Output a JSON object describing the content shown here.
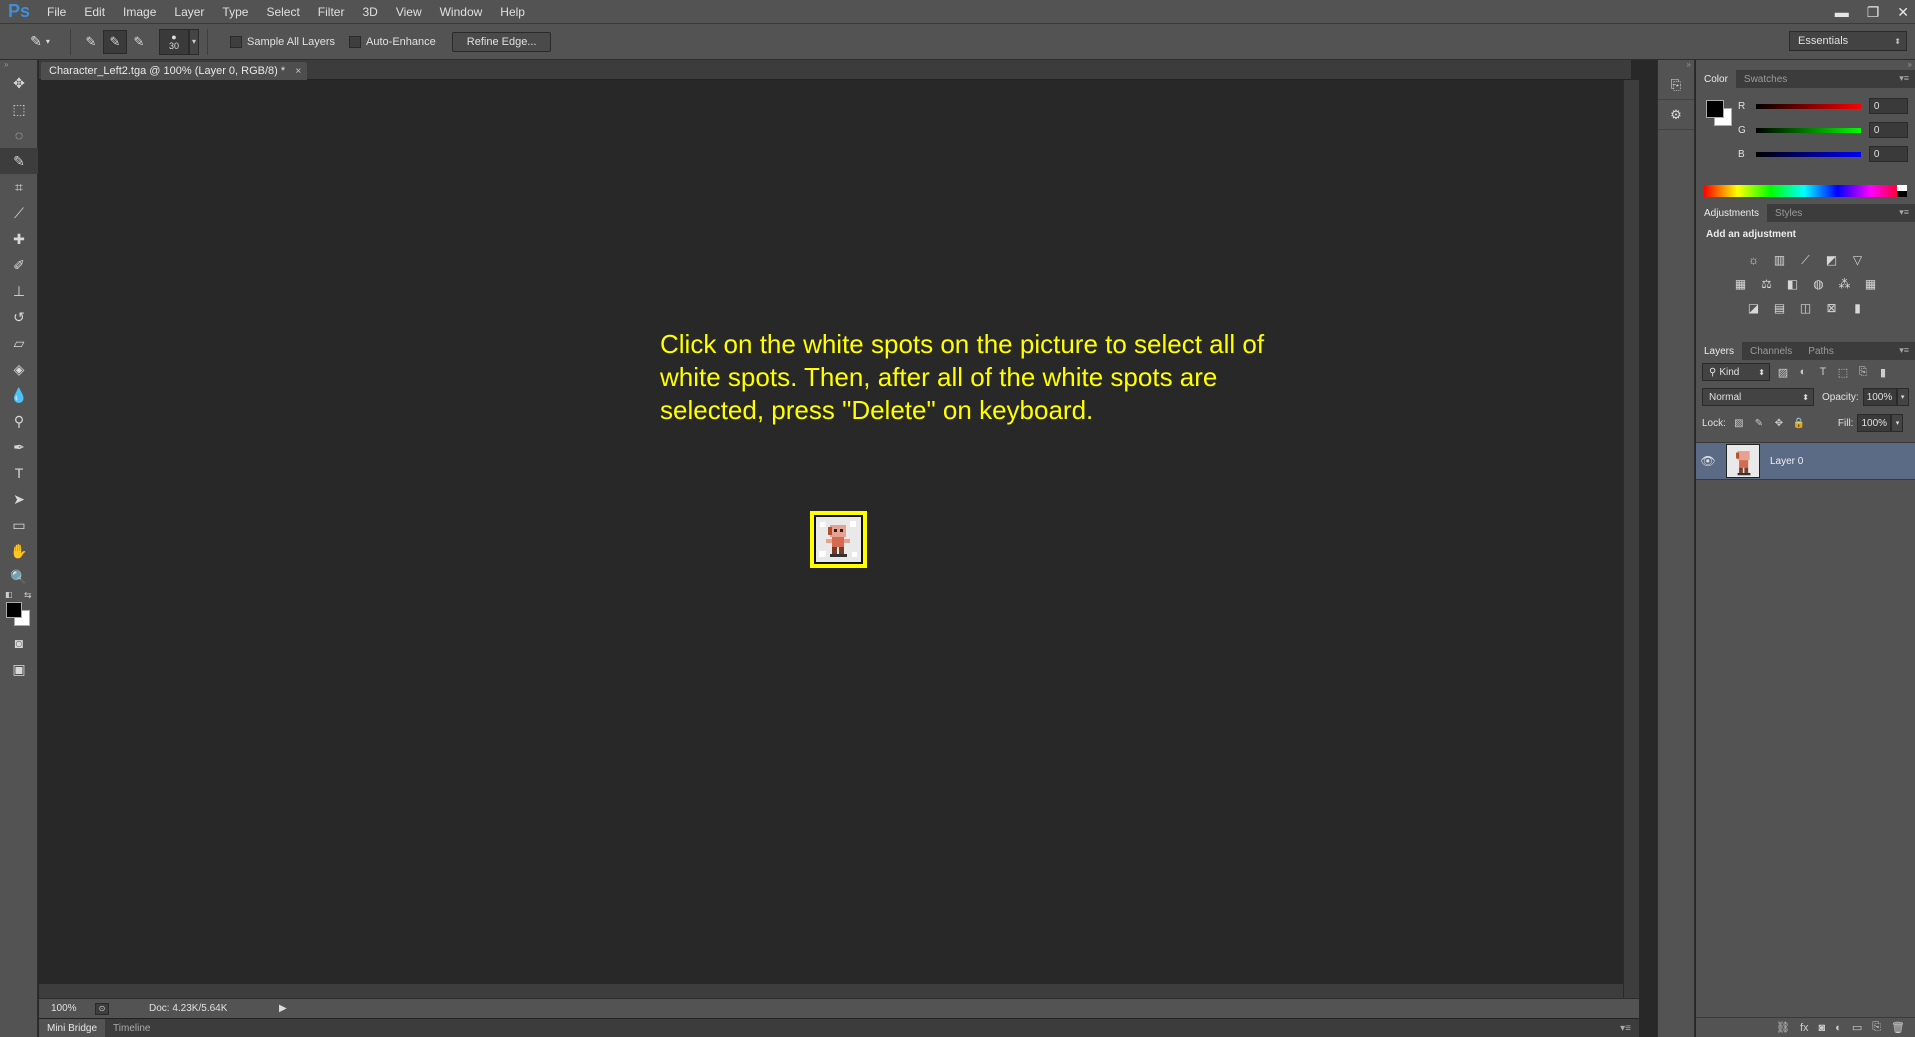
{
  "app": {
    "logo": "Ps"
  },
  "menu": [
    "File",
    "Edit",
    "Image",
    "Layer",
    "Type",
    "Select",
    "Filter",
    "3D",
    "View",
    "Window",
    "Help"
  ],
  "window_controls": {
    "minimize": "▬",
    "restore": "❐",
    "close": "✕"
  },
  "options": {
    "brush_size": "30",
    "sample_all_layers": "Sample All Layers",
    "auto_enhance": "Auto-Enhance",
    "refine_edge": "Refine Edge...",
    "workspace": "Essentials"
  },
  "document": {
    "tab_title": "Character_Left2.tga @ 100% (Layer 0, RGB/8) *",
    "instruction": "Click on the white spots on the picture to select all of white spots. Then, after all of the white spots are selected, press \"Delete\" on keyboard."
  },
  "status": {
    "zoom": "100%",
    "doc_size": "Doc: 4.23K/5.64K"
  },
  "bottom_tabs": [
    "Mini Bridge",
    "Timeline"
  ],
  "color_panel": {
    "tabs": [
      "Color",
      "Swatches"
    ],
    "r_label": "R",
    "g_label": "G",
    "b_label": "B",
    "r": "0",
    "g": "0",
    "b": "0"
  },
  "adjustments_panel": {
    "tabs": [
      "Adjustments",
      "Styles"
    ],
    "title": "Add an adjustment"
  },
  "layers_panel": {
    "tabs": [
      "Layers",
      "Channels",
      "Paths"
    ],
    "kind": "Kind",
    "blend_mode": "Normal",
    "opacity_label": "Opacity:",
    "opacity": "100%",
    "lock_label": "Lock:",
    "fill_label": "Fill:",
    "fill": "100%",
    "layer_name": "Layer 0"
  }
}
